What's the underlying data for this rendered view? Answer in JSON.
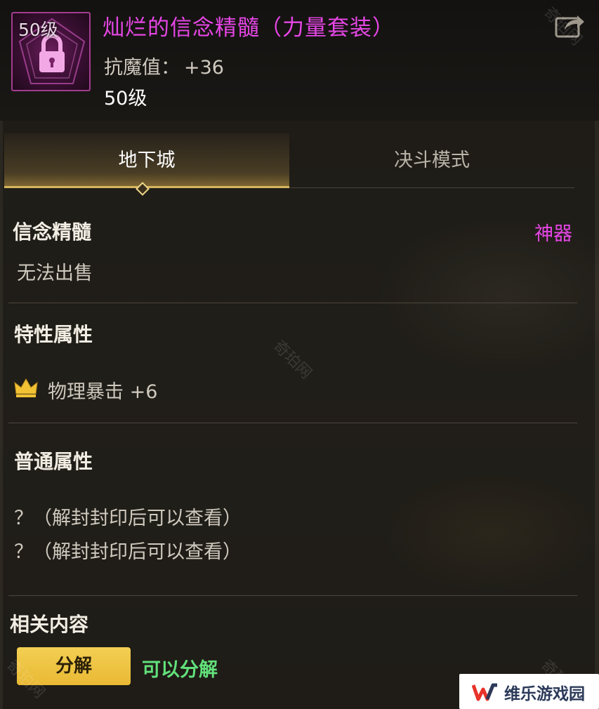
{
  "item": {
    "level_overlay": "50级",
    "name": "灿烂的信念精髓（力量套装）",
    "stat_label": "抗魔值：",
    "stat_value": "+36",
    "level": "50级"
  },
  "tabs": [
    {
      "label": "地下城",
      "active": true
    },
    {
      "label": "决斗模式",
      "active": false
    }
  ],
  "info": {
    "type_name": "信念精髓",
    "rarity": "神器",
    "trade": "无法出售"
  },
  "traits": {
    "title": "特性属性",
    "line": "物理暴击 +6"
  },
  "common": {
    "title": "普通属性",
    "lines": [
      "？（解封封印后可以查看）",
      "？（解封封印后可以查看）"
    ]
  },
  "related": {
    "title": "相关内容",
    "button": "分解",
    "status": "可以分解"
  },
  "badge": {
    "text": "维乐游戏园"
  },
  "watermark": "奇珀网",
  "colors": {
    "item_name": "#e646e6",
    "artifact": "#e646e6",
    "button": "#f3cf53",
    "status_green": "#62e07a",
    "tab_accent": "#d6b660"
  },
  "icons": [
    "lock-icon",
    "share-icon",
    "crown-icon",
    "w-logo-icon"
  ]
}
